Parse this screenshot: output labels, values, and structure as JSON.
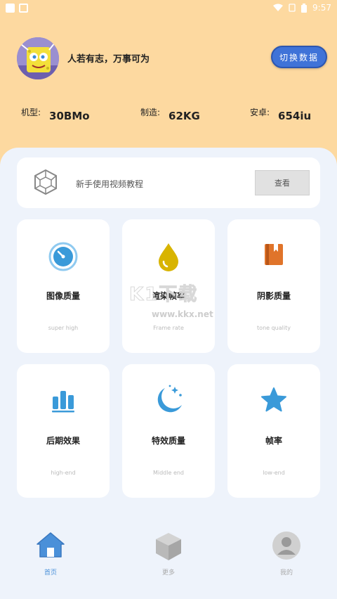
{
  "status_bar": {
    "time": "9:57"
  },
  "header": {
    "slogan": "人若有志，万事可为",
    "switch_button": "切换数据",
    "stats": [
      {
        "label": "机型:",
        "value": "30BMo"
      },
      {
        "label": "制造:",
        "value": "62KG"
      },
      {
        "label": "安卓:",
        "value": "654iu"
      }
    ]
  },
  "tutorial": {
    "text": "新手使用视频教程",
    "button": "查看"
  },
  "cards": [
    {
      "title": "图像质量",
      "subtitle": "super high",
      "icon": "gauge-icon"
    },
    {
      "title": "渲染帧率",
      "subtitle": "Frame rate",
      "icon": "drop-icon"
    },
    {
      "title": "阴影质量",
      "subtitle": "tone quality",
      "icon": "book-icon"
    },
    {
      "title": "后期效果",
      "subtitle": "high-end",
      "icon": "bars-icon"
    },
    {
      "title": "特效质量",
      "subtitle": "Middle end",
      "icon": "moon-icon"
    },
    {
      "title": "帧率",
      "subtitle": "low-end",
      "icon": "star-icon"
    }
  ],
  "watermark": {
    "text": "K1下载",
    "url": "www.kkx.net"
  },
  "nav": [
    {
      "label": "首页",
      "icon": "home-icon",
      "active": true
    },
    {
      "label": "更多",
      "icon": "cube-icon",
      "active": false
    },
    {
      "label": "我的",
      "icon": "user-icon",
      "active": false
    }
  ],
  "colors": {
    "header_bg": "#fdd9a0",
    "panel_bg": "#eef3fb",
    "accent_blue": "#3f73d8",
    "icon_blue": "#3a9ad9",
    "drop_yellow": "#d8b400",
    "book_orange": "#e0742a",
    "nav_active": "#4a90d9"
  }
}
